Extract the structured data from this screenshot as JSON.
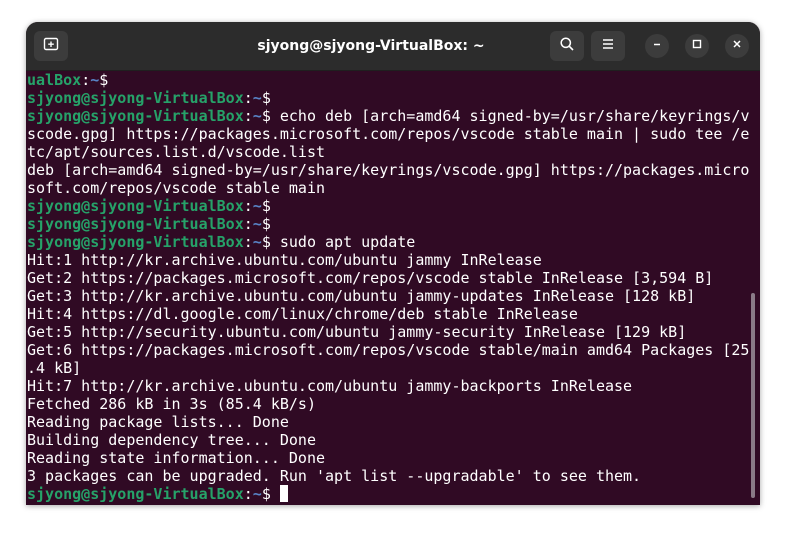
{
  "window": {
    "title": "sjyong@sjyong-VirtualBox: ~"
  },
  "titlebar": {
    "new_tab_icon": "new-tab-icon",
    "search_icon": "search-icon",
    "menu_icon": "hamburger-menu-icon",
    "minimize_icon": "minimize-icon",
    "maximize_icon": "maximize-icon",
    "close_icon": "close-icon"
  },
  "colors": {
    "terminal_bg": "#300a24",
    "prompt_user": "#26a269",
    "prompt_path": "#5884c7",
    "text": "#ffffff",
    "titlebar_bg": "#2c2c2c"
  },
  "terminal": {
    "lines": [
      {
        "type": "prompt",
        "user": "ualBox",
        "sep": ":",
        "path": "~",
        "sym": "$",
        "cmd": ""
      },
      {
        "type": "prompt",
        "user": "sjyong@sjyong-VirtualBox",
        "sep": ":",
        "path": "~",
        "sym": "$",
        "cmd": ""
      },
      {
        "type": "prompt",
        "user": "sjyong@sjyong-VirtualBox",
        "sep": ":",
        "path": "~",
        "sym": "$",
        "cmd": " echo deb [arch=amd64 signed-by=/usr/share/keyrings/v"
      },
      {
        "type": "text",
        "text": "scode.gpg] https://packages.microsoft.com/repos/vscode stable main | sudo tee /e"
      },
      {
        "type": "text",
        "text": "tc/apt/sources.list.d/vscode.list"
      },
      {
        "type": "text",
        "text": "deb [arch=amd64 signed-by=/usr/share/keyrings/vscode.gpg] https://packages.micro"
      },
      {
        "type": "text",
        "text": "soft.com/repos/vscode stable main"
      },
      {
        "type": "prompt",
        "user": "sjyong@sjyong-VirtualBox",
        "sep": ":",
        "path": "~",
        "sym": "$",
        "cmd": ""
      },
      {
        "type": "prompt",
        "user": "sjyong@sjyong-VirtualBox",
        "sep": ":",
        "path": "~",
        "sym": "$",
        "cmd": ""
      },
      {
        "type": "prompt",
        "user": "sjyong@sjyong-VirtualBox",
        "sep": ":",
        "path": "~",
        "sym": "$",
        "cmd": " sudo apt update"
      },
      {
        "type": "text",
        "text": "Hit:1 http://kr.archive.ubuntu.com/ubuntu jammy InRelease"
      },
      {
        "type": "text",
        "text": "Get:2 https://packages.microsoft.com/repos/vscode stable InRelease [3,594 B]"
      },
      {
        "type": "text",
        "text": "Get:3 http://kr.archive.ubuntu.com/ubuntu jammy-updates InRelease [128 kB]"
      },
      {
        "type": "text",
        "text": "Hit:4 https://dl.google.com/linux/chrome/deb stable InRelease"
      },
      {
        "type": "text",
        "text": "Get:5 http://security.ubuntu.com/ubuntu jammy-security InRelease [129 kB]"
      },
      {
        "type": "text",
        "text": "Get:6 https://packages.microsoft.com/repos/vscode stable/main amd64 Packages [25"
      },
      {
        "type": "text",
        "text": ".4 kB]"
      },
      {
        "type": "text",
        "text": "Hit:7 http://kr.archive.ubuntu.com/ubuntu jammy-backports InRelease"
      },
      {
        "type": "text",
        "text": "Fetched 286 kB in 3s (85.4 kB/s)"
      },
      {
        "type": "text",
        "text": "Reading package lists... Done"
      },
      {
        "type": "text",
        "text": "Building dependency tree... Done"
      },
      {
        "type": "text",
        "text": "Reading state information... Done"
      },
      {
        "type": "text",
        "text": "3 packages can be upgraded. Run 'apt list --upgradable' to see them."
      },
      {
        "type": "prompt",
        "user": "sjyong@sjyong-VirtualBox",
        "sep": ":",
        "path": "~",
        "sym": "$",
        "cmd": " ",
        "cursor": true
      }
    ]
  }
}
